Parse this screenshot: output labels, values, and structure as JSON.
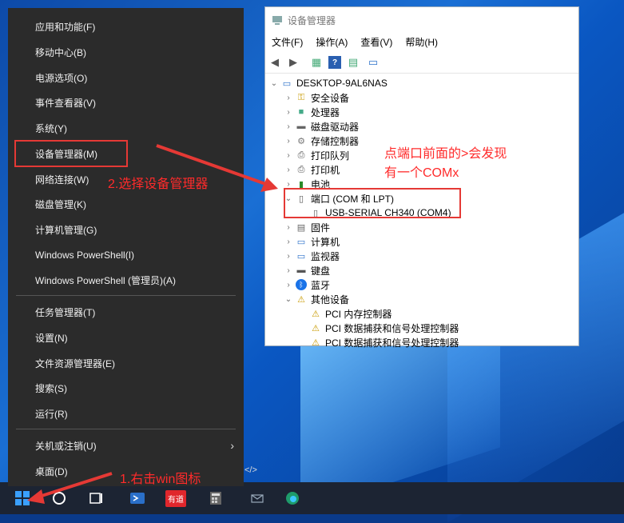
{
  "winx_menu": {
    "items": [
      {
        "label": "应用和功能(F)"
      },
      {
        "label": "移动中心(B)"
      },
      {
        "label": "电源选项(O)"
      },
      {
        "label": "事件查看器(V)"
      },
      {
        "label": "系统(Y)"
      },
      {
        "label": "设备管理器(M)"
      },
      {
        "label": "网络连接(W)"
      },
      {
        "label": "磁盘管理(K)"
      },
      {
        "label": "计算机管理(G)"
      },
      {
        "label": "Windows PowerShell(I)"
      },
      {
        "label": "Windows PowerShell (管理员)(A)"
      },
      {
        "label": "任务管理器(T)"
      },
      {
        "label": "设置(N)"
      },
      {
        "label": "文件资源管理器(E)"
      },
      {
        "label": "搜索(S)"
      },
      {
        "label": "运行(R)"
      },
      {
        "label": "关机或注销(U)"
      },
      {
        "label": "桌面(D)"
      }
    ]
  },
  "device_manager": {
    "title": "设备管理器",
    "menu": [
      "文件(F)",
      "操作(A)",
      "查看(V)",
      "帮助(H)"
    ],
    "root": "DESKTOP-9AL6NAS",
    "nodes": [
      {
        "label": "安全设备"
      },
      {
        "label": "处理器"
      },
      {
        "label": "磁盘驱动器"
      },
      {
        "label": "存储控制器"
      },
      {
        "label": "打印队列"
      },
      {
        "label": "打印机"
      },
      {
        "label": "电池"
      },
      {
        "label": "端口 (COM 和 LPT)"
      },
      {
        "label": "USB-SERIAL CH340 (COM4)"
      },
      {
        "label": "固件"
      },
      {
        "label": "计算机"
      },
      {
        "label": "监视器"
      },
      {
        "label": "键盘"
      },
      {
        "label": "蓝牙"
      },
      {
        "label": "其他设备"
      },
      {
        "label": "PCI 内存控制器"
      },
      {
        "label": "PCI 数据捕获和信号处理控制器"
      },
      {
        "label": "PCI 数据捕获和信号处理控制器"
      }
    ]
  },
  "annotations": {
    "step1": "1.右击win图标",
    "step2": "2.选择设备管理器",
    "note_line1": "点端口前面的>会发现",
    "note_line2": "有一个COMx"
  },
  "taskbar": {
    "youdao_label": "有道",
    "code_hint": "</>"
  },
  "colors": {
    "annotation_red": "#ff2b2b",
    "menu_bg": "#2b2b2b",
    "taskbar_bg": "#1c2433"
  }
}
